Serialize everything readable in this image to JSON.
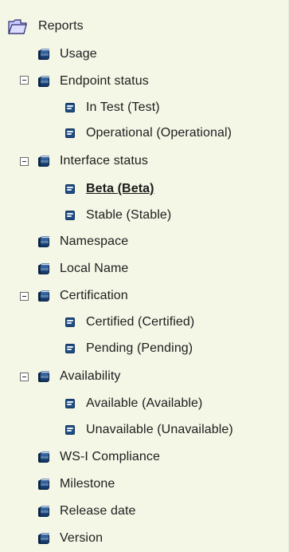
{
  "tree": {
    "root": {
      "label": "Reports",
      "icon": "folder-open-icon"
    },
    "items": [
      {
        "label": "Usage"
      },
      {
        "label": "Endpoint status"
      },
      {
        "label": "In Test (Test)"
      },
      {
        "label": "Operational (Operational)"
      },
      {
        "label": "Interface status"
      },
      {
        "label": "Beta (Beta)"
      },
      {
        "label": "Stable (Stable)"
      },
      {
        "label": "Namespace"
      },
      {
        "label": "Local Name"
      },
      {
        "label": "Certification"
      },
      {
        "label": "Certified (Certified)"
      },
      {
        "label": "Pending (Pending)"
      },
      {
        "label": "Availability"
      },
      {
        "label": "Available (Available)"
      },
      {
        "label": "Unavailable (Unavailable)"
      },
      {
        "label": "WS-I Compliance"
      },
      {
        "label": "Milestone"
      },
      {
        "label": "Release date"
      },
      {
        "label": "Version"
      }
    ],
    "selected": "Beta (Beta)"
  },
  "colors": {
    "background": "#f4f6e6",
    "icon_blue": "#1e4c86",
    "text": "#1e1e1e"
  }
}
